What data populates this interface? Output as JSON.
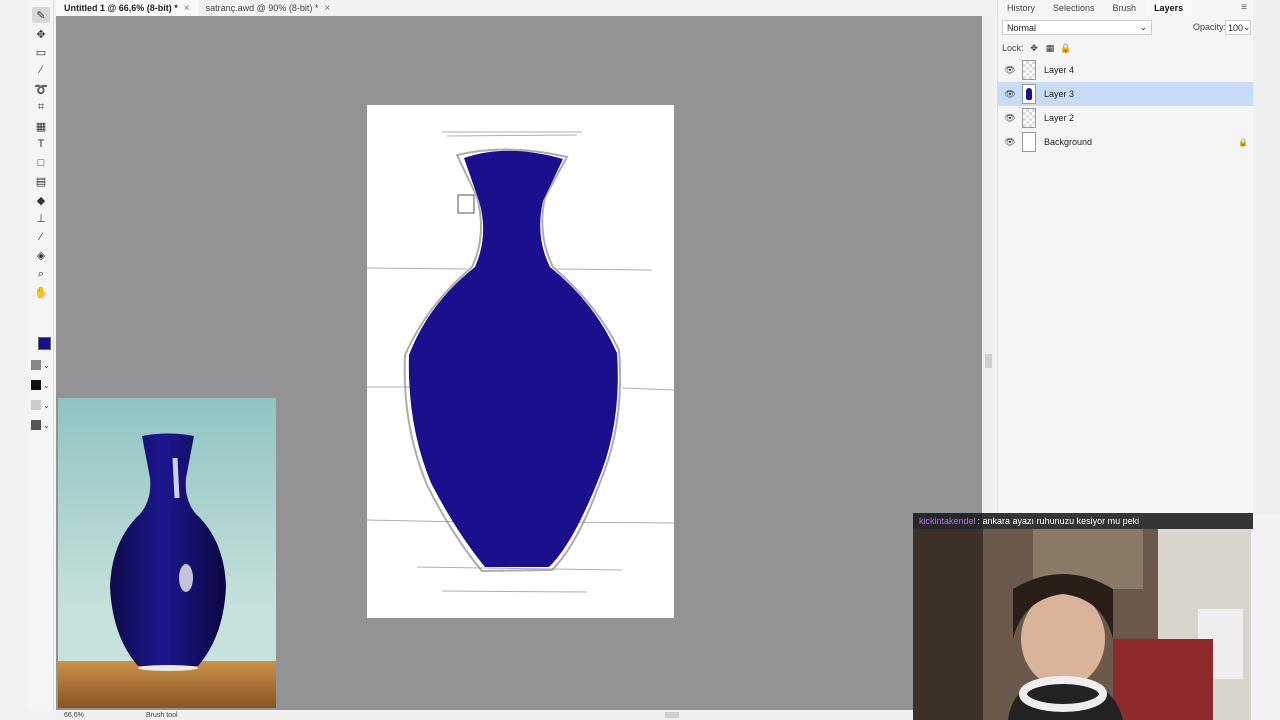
{
  "tabs": [
    {
      "label": "Untitled 1 @ 66,6% (8-bit) *",
      "close": "×"
    },
    {
      "label": "satranç.awd @ 90% (8-bit) *",
      "close": "×"
    }
  ],
  "panel": {
    "tabs": [
      "History",
      "Selections",
      "Brush",
      "Layers"
    ],
    "active_tab": "Layers",
    "blend_mode": "Normal",
    "opacity_label": "Opacity:",
    "opacity_value": "100",
    "lock_label": "Lock:",
    "layers": [
      {
        "name": "Layer 4",
        "selected": false,
        "locked": false
      },
      {
        "name": "Layer 3",
        "selected": true,
        "locked": false
      },
      {
        "name": "Layer 2",
        "selected": false,
        "locked": false
      },
      {
        "name": "Background",
        "selected": false,
        "locked": true
      }
    ]
  },
  "status": {
    "zoom": "66,6%",
    "tool": "Brush tool"
  },
  "colors": {
    "foreground": "#1a0f8c",
    "vase": "#1a0f8c",
    "workspace": "#939393"
  },
  "chat": {
    "user": "kickintakendel",
    "message": ": ankara ayazı ruhunuzu kesiyor mu peki"
  },
  "icons": [
    "brush-icon",
    "move-icon",
    "marquee-icon",
    "magic-wand-icon",
    "lasso-icon",
    "crop-icon",
    "slice-icon",
    "text-icon",
    "shape-icon",
    "gradient-icon",
    "eraser-icon",
    "stamp-icon",
    "eyedropper-icon",
    "bucket-icon",
    "zoom-icon",
    "hand-icon"
  ]
}
